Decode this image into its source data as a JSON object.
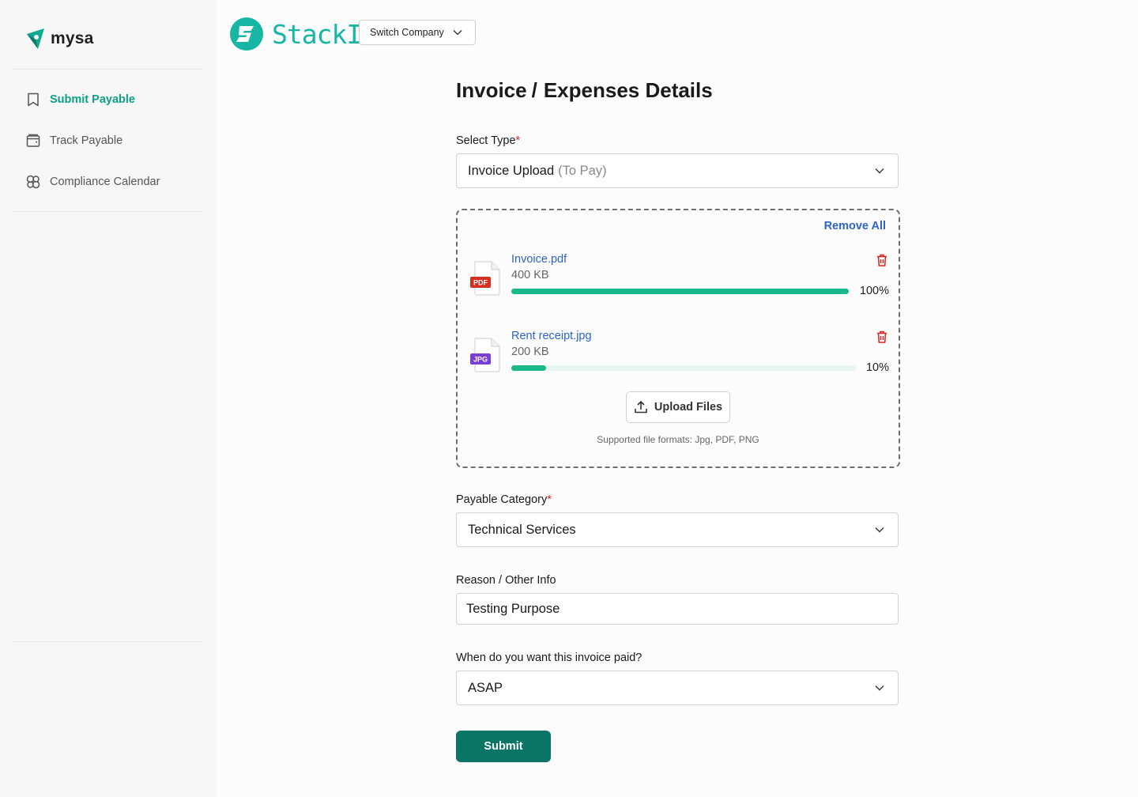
{
  "sidebar": {
    "logo_text": "mysa",
    "items": [
      {
        "label": "Submit Payable",
        "icon": "bookmark-icon",
        "active": true
      },
      {
        "label": "Track Payable",
        "icon": "wallet-icon",
        "active": false
      },
      {
        "label": "Compliance Calendar",
        "icon": "calendar-icon",
        "active": false
      }
    ]
  },
  "header": {
    "brand_name": "StackIt",
    "switch_company_label": "Switch Company"
  },
  "form": {
    "title_part1": "Invoice",
    "title_sep": "/",
    "title_part2": "Expenses Details",
    "select_type": {
      "label": "Select Type",
      "required_mark": "*",
      "value": "Invoice Upload",
      "value_suffix": "(To Pay)"
    },
    "upload": {
      "remove_all_label": "Remove All",
      "files": [
        {
          "name": "Invoice.pdf",
          "size": "400 KB",
          "type_badge": "PDF",
          "progress": 100,
          "progress_label": "100%"
        },
        {
          "name": "Rent receipt.jpg",
          "size": "200 KB",
          "type_badge": "JPG",
          "progress": 10,
          "progress_label": "10%"
        }
      ],
      "upload_button_label": "Upload Files",
      "supported_formats": "Supported file formats: Jpg, PDF, PNG"
    },
    "payable_category": {
      "label": "Payable Category",
      "required_mark": "*",
      "value": "Technical Services"
    },
    "reason": {
      "label": "Reason / Other Info",
      "value": "Testing Purpose"
    },
    "paid_when": {
      "label": "When do you want this invoice paid?",
      "value": "ASAP"
    },
    "submit_label": "Submit"
  },
  "colors": {
    "accent": "#0e9f85",
    "brand": "#17b6a4",
    "link": "#2d63c8",
    "progress": "#1bb889",
    "submit_bg": "#0b7566",
    "danger": "#e02020",
    "pdf_badge": "#d92d20",
    "jpg_badge": "#7a3fd6"
  }
}
